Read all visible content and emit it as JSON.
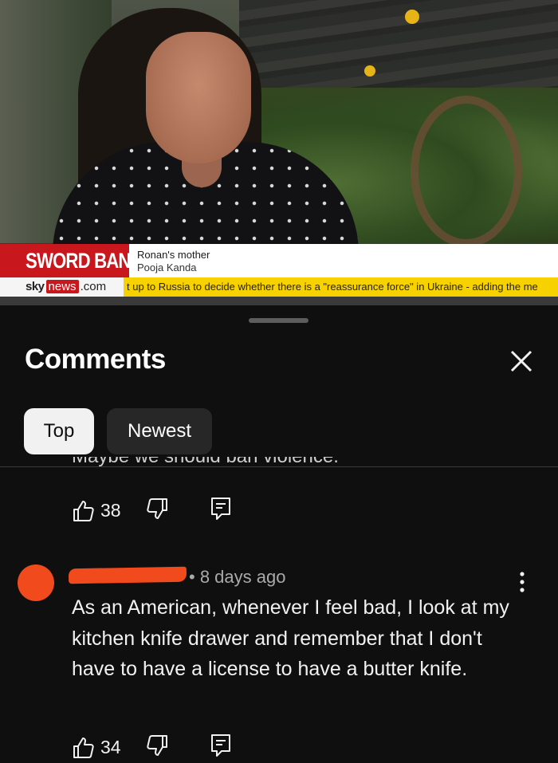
{
  "video": {
    "headline": "SWORD BAN",
    "name_title": "Ronan's mother",
    "name": "Pooja Kanda",
    "logo_sky": "sky",
    "logo_news": "news",
    "logo_com": ".com",
    "ticker": "t up to Russia to decide whether there is a \"reassurance force\" in Ukraine - adding the me"
  },
  "comments": {
    "title": "Comments",
    "close_icon": "close-icon",
    "sort_tabs": [
      {
        "label": "Top",
        "selected": true
      },
      {
        "label": "Newest",
        "selected": false
      }
    ],
    "truncated_text": "Maybe we should ban violence.",
    "items": [
      {
        "likes": "38"
      },
      {
        "time": "• 8 days ago",
        "text": "As an American, whenever I feel bad, I look at my kitchen knife drawer and remember that I don't have to have a license to have a butter knife.",
        "likes": "34"
      }
    ]
  },
  "colors": {
    "background": "#0f0f0f",
    "headline_red": "#c8181d",
    "ticker_yellow": "#f7d200",
    "avatar_orange": "#f14a1c"
  }
}
